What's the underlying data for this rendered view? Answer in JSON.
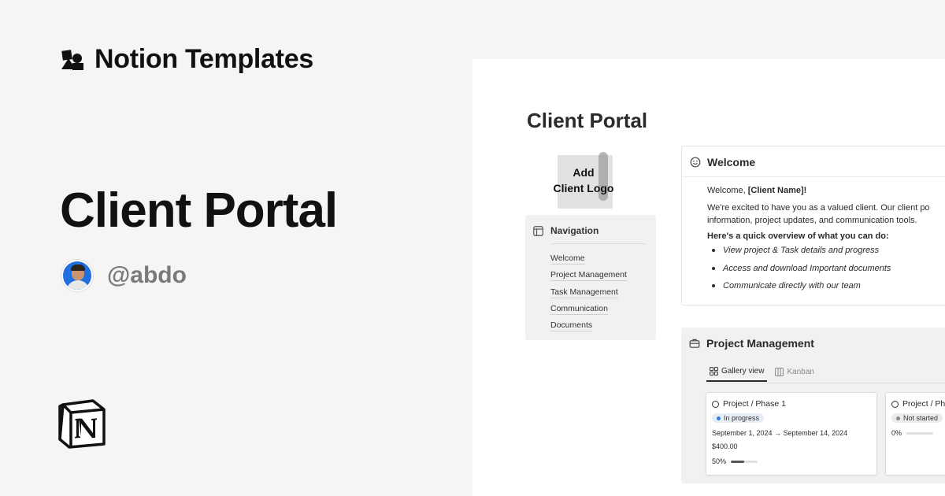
{
  "brand": {
    "name": "Notion Templates",
    "icon": "notion-templates-shapes-icon"
  },
  "hero": {
    "title": "Client Portal"
  },
  "author": {
    "handle": "@abdo",
    "avatar": "avatar-photo"
  },
  "footer_logo": {
    "icon": "notion-logo-icon"
  },
  "page": {
    "title": "Client Portal",
    "logo_placeholder": {
      "line1": "Add",
      "line2": "Client Logo"
    },
    "navigation": {
      "title": "Navigation",
      "icon": "layout-icon",
      "items": [
        "Welcome",
        "Project Management",
        "Task Management",
        "Communication",
        "Documents"
      ]
    },
    "welcome": {
      "title": "Welcome",
      "icon": "smile-icon",
      "greeting_prefix": "Welcome, ",
      "greeting_name": "[Client Name]!",
      "line1": "We're excited to have you as a valued client. Our client po",
      "line2": "information, project updates, and communication tools.",
      "overview": "Here's a quick overview of what you can do:",
      "bullets": [
        "View project & Task details and progress",
        "Access and download Important documents",
        "Communicate directly with our team"
      ]
    },
    "project_management": {
      "title": "Project Management",
      "icon": "briefcase-icon",
      "tabs": [
        {
          "label": "Gallery view",
          "icon": "gallery-icon",
          "active": true
        },
        {
          "label": "Kanban",
          "icon": "kanban-icon",
          "active": false
        }
      ],
      "cards": [
        {
          "title": "Project / Phase 1",
          "status": "In progress",
          "status_color": "#3a7bd5",
          "dates": "September 1, 2024 → September 14, 2024",
          "amount": "$400.00",
          "progress_label": "50%",
          "progress": 0.5
        },
        {
          "title": "Project / Ph",
          "status": "Not started",
          "status_color": "#8b8b8b",
          "progress_label": "0%",
          "progress": 0
        }
      ]
    }
  }
}
